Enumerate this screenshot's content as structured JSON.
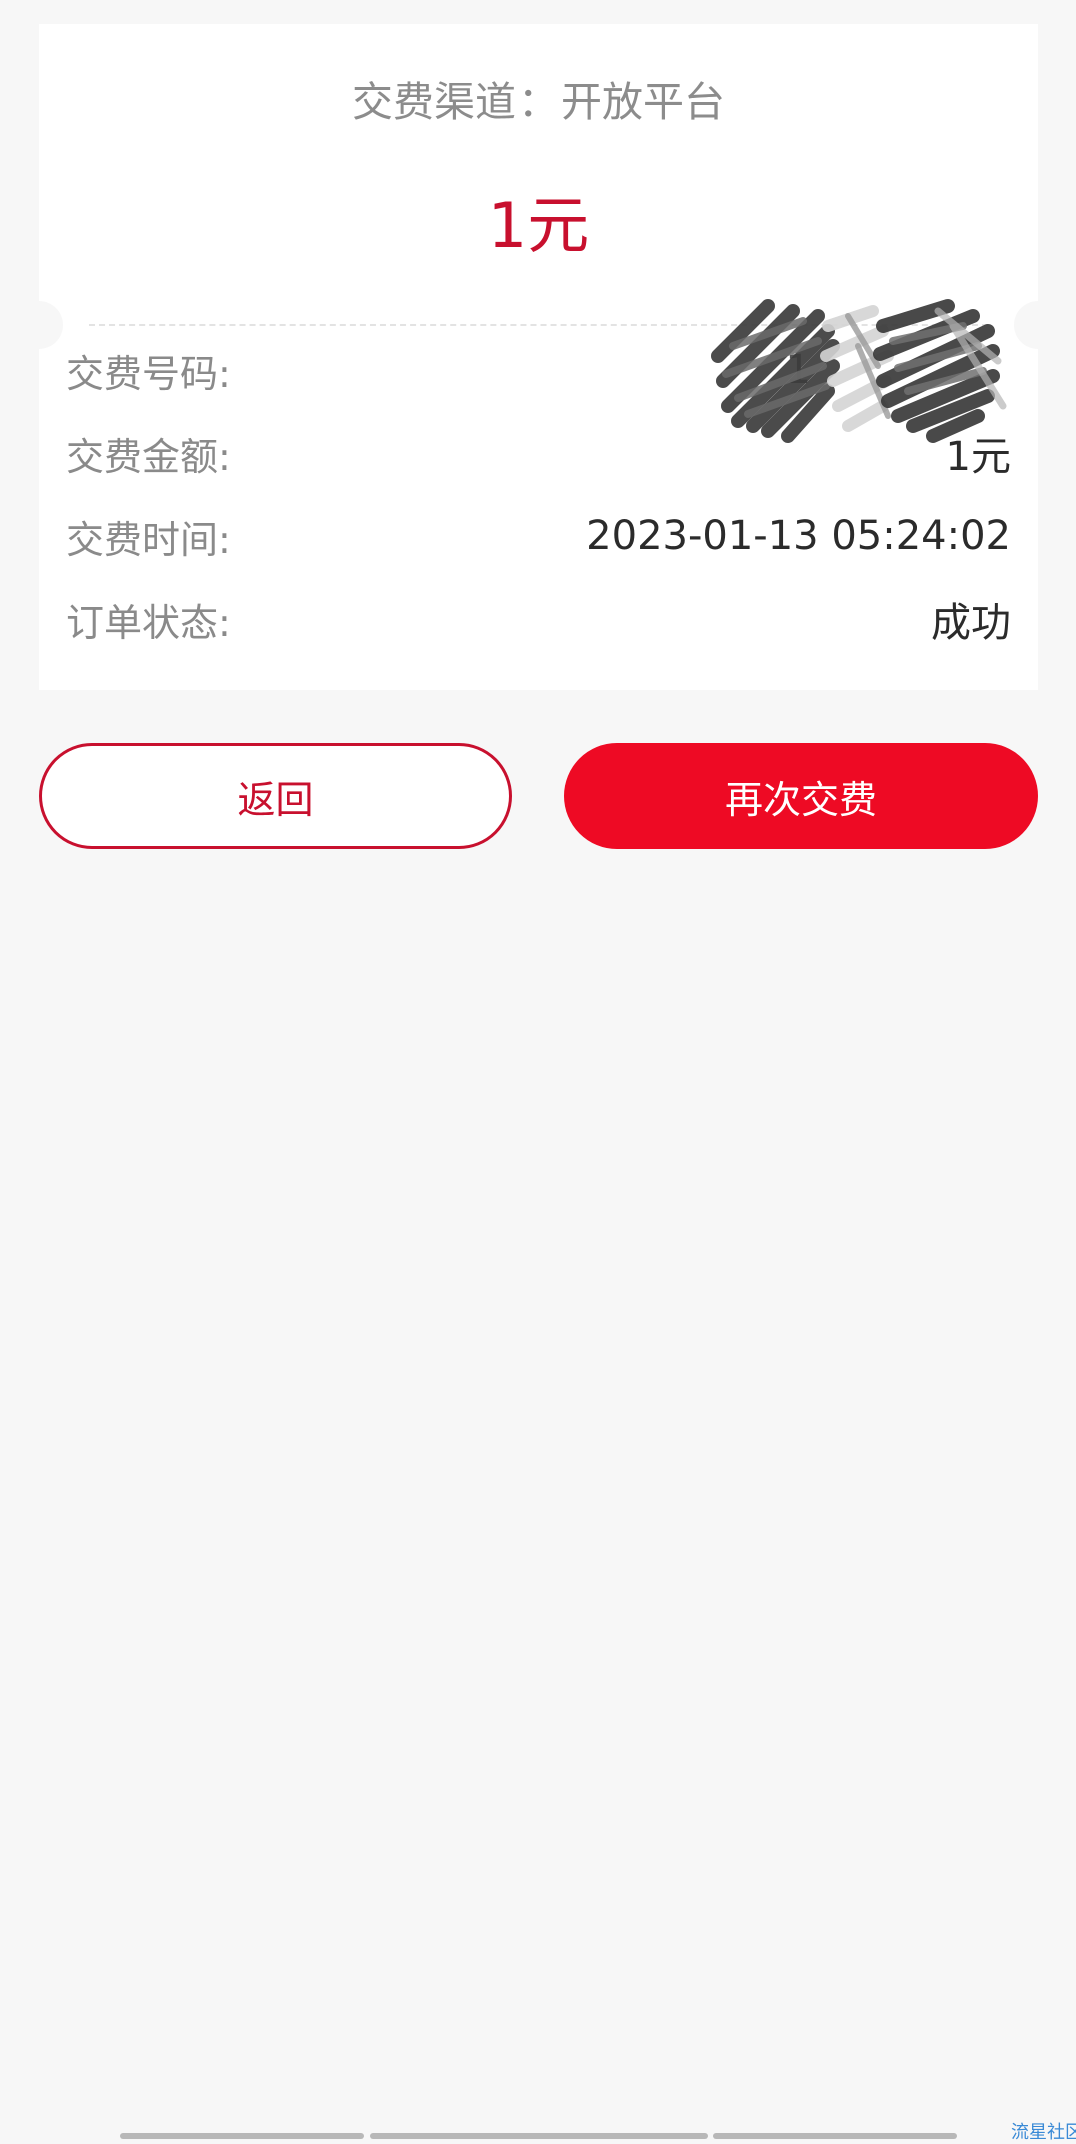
{
  "receipt": {
    "channel_label": "交费渠道",
    "channel_separator": "：",
    "channel_value": "开放平台",
    "amount_display": "1元",
    "rows": [
      {
        "label": "交费号码:",
        "value": "1"
      },
      {
        "label": "交费金额:",
        "value": "1元"
      },
      {
        "label": "交费时间:",
        "value": "2023-01-13 05:24:02"
      },
      {
        "label": "订单状态:",
        "value": "成功"
      }
    ]
  },
  "actions": {
    "back_label": "返回",
    "pay_again_label": "再次交费"
  },
  "watermark": "流星社区",
  "colors": {
    "accent": "#ee0a24",
    "accent_dark": "#c8102e",
    "background": "#f7f7f7",
    "card": "#ffffff"
  }
}
